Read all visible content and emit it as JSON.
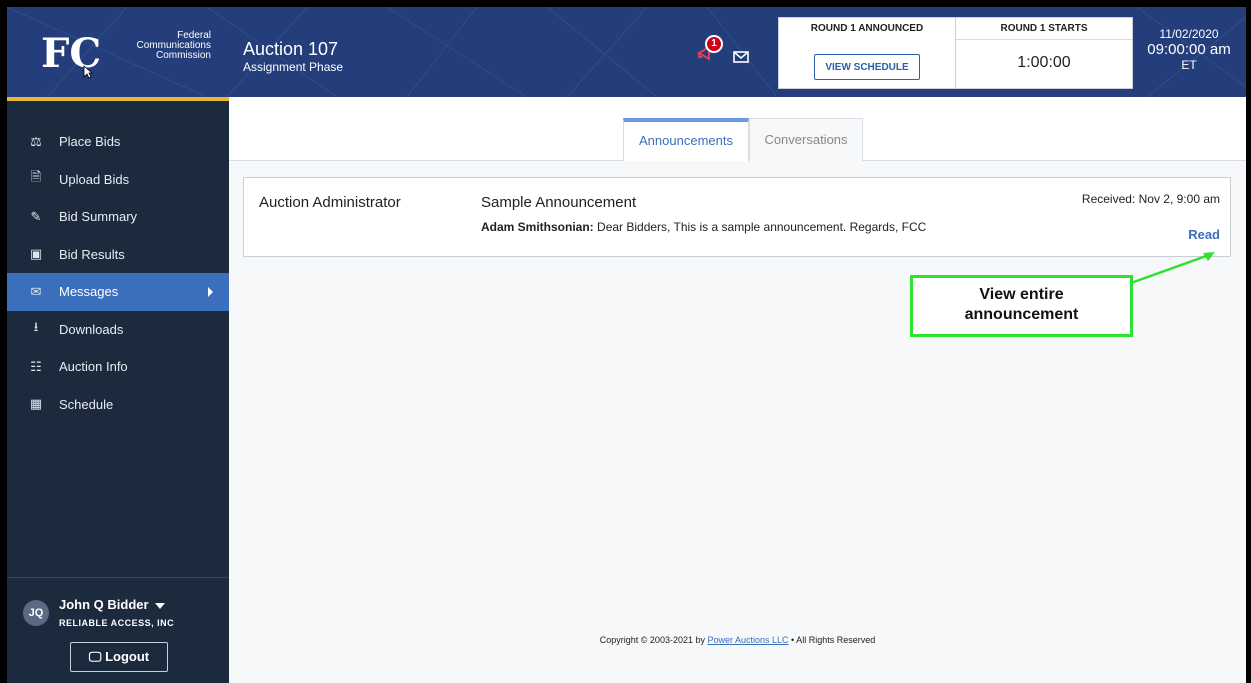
{
  "header": {
    "org_line1": "Federal",
    "org_line2": "Communications",
    "org_line3": "Commission",
    "logo_text": "FCC",
    "app_title": "Auction 107",
    "app_subtitle": "Assignment Phase",
    "notification_count": "1",
    "round_announced_label": "ROUND 1 ANNOUNCED",
    "view_schedule_label": "VIEW SCHEDULE",
    "round_starts_label": "ROUND 1 STARTS",
    "countdown": "1:00:00",
    "date": "11/02/2020",
    "time": "09:00:00 am",
    "timezone": "ET"
  },
  "sidebar": {
    "items": [
      {
        "label": "Place Bids",
        "icon": "gavel-icon"
      },
      {
        "label": "Upload Bids",
        "icon": "upload-file-icon"
      },
      {
        "label": "Bid Summary",
        "icon": "edit-doc-icon"
      },
      {
        "label": "Bid Results",
        "icon": "results-board-icon"
      },
      {
        "label": "Messages",
        "icon": "envelope-icon"
      },
      {
        "label": "Downloads",
        "icon": "download-icon"
      },
      {
        "label": "Auction Info",
        "icon": "clipboard-icon"
      },
      {
        "label": "Schedule",
        "icon": "calendar-icon"
      }
    ],
    "active_item": "Messages",
    "user_initials": "JQ",
    "user_name": "John Q Bidder",
    "user_org": "RELIABLE ACCESS, INC",
    "logout_label": "Logout"
  },
  "main": {
    "tabs": [
      {
        "label": "Announcements"
      },
      {
        "label": "Conversations"
      }
    ],
    "announcement": {
      "from": "Auction Administrator",
      "title": "Sample Announcement",
      "sender": "Adam Smithsonian:",
      "body": " Dear Bidders, This is a sample announcement. Regards, FCC",
      "received": "Received: Nov 2, 9:00 am",
      "read_label": "Read"
    },
    "callout_line1": "View entire",
    "callout_line2": "announcement"
  },
  "footer": {
    "prefix": "Copyright © 2003-2021 by ",
    "link": "Power Auctions LLC",
    "suffix": " • All Rights Reserved"
  },
  "colors": {
    "header_bg": "#233e7b",
    "sidebar_bg": "#1c2a3e",
    "active_nav": "#3b6fbc",
    "accent_bar": "#e8b73a",
    "badge": "#d0021b",
    "callout_border": "#2fe22f"
  }
}
